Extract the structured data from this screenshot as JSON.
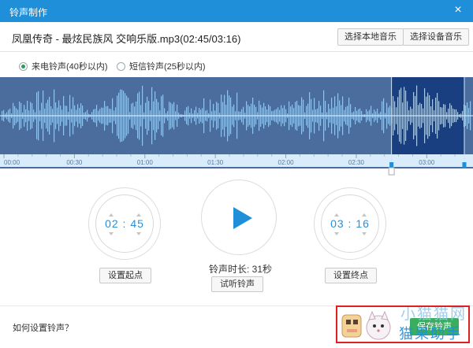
{
  "window": {
    "title": "铃声制作",
    "close_glyph": "×"
  },
  "header": {
    "song_title": "凤凰传奇 - 最炫民族风 交响乐版.mp3(02:45/03:16)",
    "btn_local": "选择本地音乐",
    "btn_device": "选择设备音乐"
  },
  "modes": [
    {
      "label": "来电铃声(40秒以内)",
      "selected": true
    },
    {
      "label": "短信铃声(25秒以内)",
      "selected": false
    }
  ],
  "timeline": {
    "ticks": [
      "00:00",
      "00:30",
      "01:00",
      "01:30",
      "02:00",
      "02:30",
      "03:00"
    ],
    "total_seconds": 196,
    "selection_start_seconds": 165,
    "selection_end_seconds": 196
  },
  "colors": {
    "accent": "#1e8fd8",
    "wave_bg": "#4a6d9e",
    "wave_selected_bg": "#1a3f80",
    "save_green": "#3aad5f",
    "radio_green": "#2a9d5c"
  },
  "start": {
    "time": "02 : 45",
    "button": "设置起点"
  },
  "end": {
    "time": "03 : 16",
    "button": "设置终点"
  },
  "player": {
    "duration_label": "铃声时长: 31秒",
    "listen_button": "试听铃声",
    "play_icon": "play-icon"
  },
  "footer": {
    "howto": "如何设置铃声？",
    "save": "保存铃声",
    "watermark_top": "小猫猫网",
    "watermark_bottom": "猫果助手"
  }
}
